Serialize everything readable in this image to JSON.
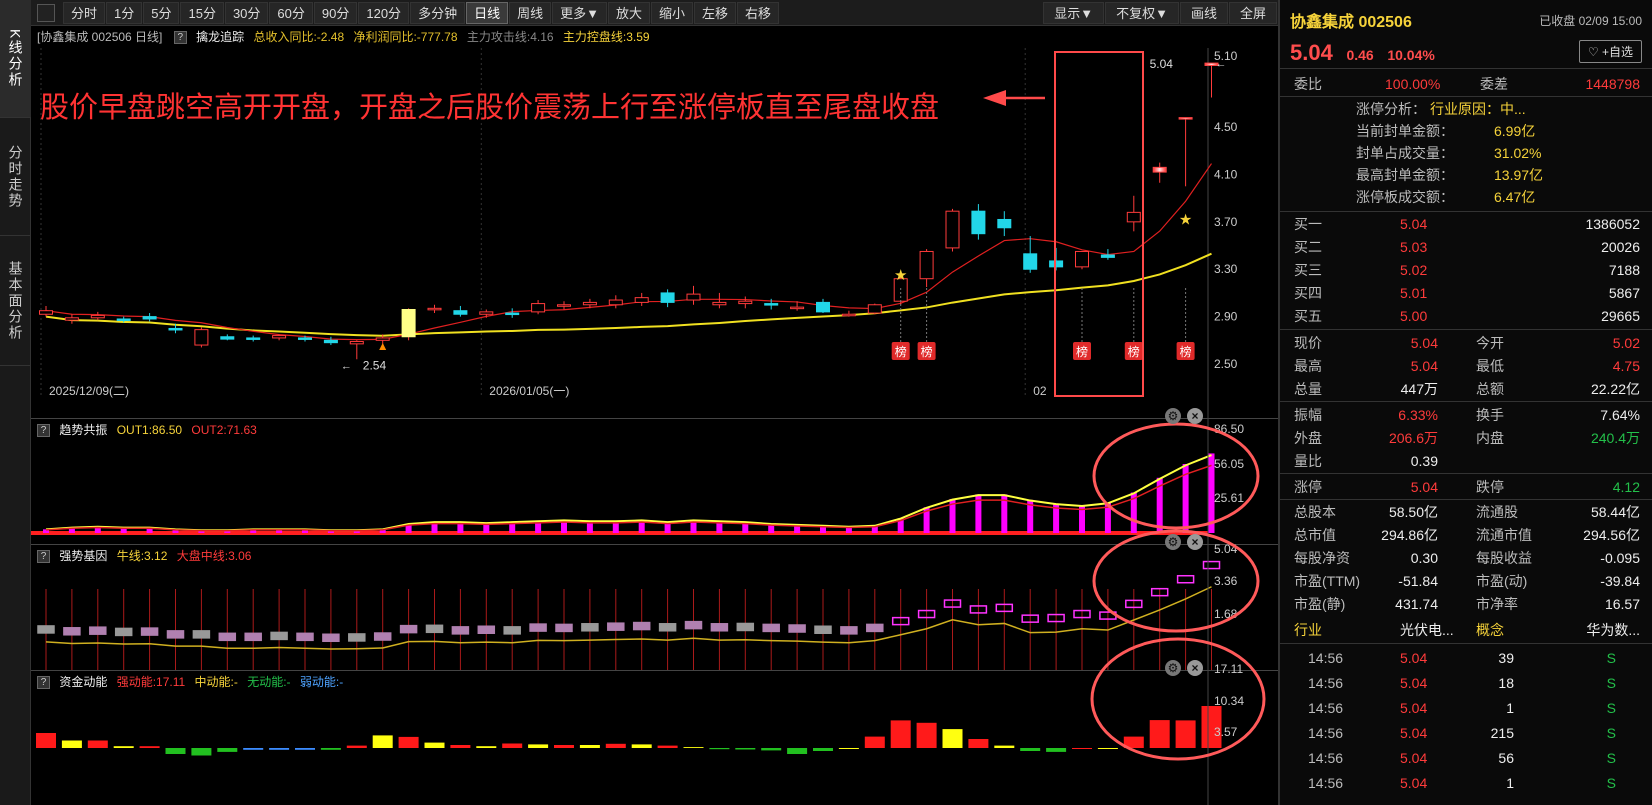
{
  "nav": {
    "tabs": [
      {
        "label": "K线分析"
      },
      {
        "label": "分时走势"
      },
      {
        "label": "基本面分析"
      }
    ]
  },
  "toolbar": {
    "buttons": [
      "分时",
      "1分",
      "5分",
      "15分",
      "30分",
      "60分",
      "90分",
      "120分",
      "多分钟",
      "日线",
      "周线",
      "更多▼",
      "放大",
      "缩小",
      "左移",
      "右移"
    ],
    "active": "日线",
    "right": [
      "显示▼",
      "不复权▼",
      "画线",
      "全屏"
    ]
  },
  "kline": {
    "info_title": "[协鑫集成 002506 日线]",
    "indicator": "擒龙追踪",
    "income": "总收入同比:-2.48",
    "profit": "净利润同比:-777.78",
    "attack": "主力攻击线:4.16",
    "control": "主力控盘线:3.59",
    "yticks": [
      "5.10",
      "4.50",
      "4.10",
      "3.70",
      "3.30",
      "2.90",
      "2.50"
    ],
    "dates": [
      "2025/12/09(二)",
      "2026/01/05(一)",
      "02"
    ],
    "low_label": "2.54",
    "high_label": "5.04",
    "bang": "榜",
    "annotation": "股价早盘跳空高开开盘，开盘之后股价震荡上行至涨停板直至尾盘收盘"
  },
  "trend": {
    "name": "趋势共振",
    "out1": "OUT1:86.50",
    "out2": "OUT2:71.63",
    "yticks": [
      "86.50",
      "56.05",
      "25.61"
    ]
  },
  "gene": {
    "name": "强势基因",
    "bull": "牛线:3.12",
    "big": "大盘中线:3.06",
    "yticks": [
      "5.04",
      "3.36",
      "1.68"
    ]
  },
  "money": {
    "name": "资金动能",
    "strong": "强动能:17.11",
    "mid": "中动能:-",
    "none": "无动能:-",
    "weak": "弱动能:-",
    "yticks": [
      "17.11",
      "10.34",
      "3.57"
    ]
  },
  "chart_data": {
    "type": "candlestick",
    "ohlc": [
      [
        2.92,
        2.99,
        2.9,
        2.95
      ],
      [
        2.87,
        2.92,
        2.84,
        2.89
      ],
      [
        2.89,
        2.94,
        2.87,
        2.91
      ],
      [
        2.88,
        2.9,
        2.85,
        2.87
      ],
      [
        2.9,
        2.93,
        2.86,
        2.88
      ],
      [
        2.8,
        2.84,
        2.76,
        2.79
      ],
      [
        2.66,
        2.81,
        2.64,
        2.79
      ],
      [
        2.73,
        2.75,
        2.7,
        2.71
      ],
      [
        2.72,
        2.74,
        2.69,
        2.71
      ],
      [
        2.72,
        2.75,
        2.7,
        2.74
      ],
      [
        2.72,
        2.74,
        2.69,
        2.71
      ],
      [
        2.7,
        2.73,
        2.66,
        2.68
      ],
      [
        2.67,
        2.7,
        2.54,
        2.69
      ],
      [
        2.7,
        2.75,
        2.65,
        2.72
      ],
      [
        2.73,
        2.97,
        2.7,
        2.96
      ],
      [
        2.96,
        3.0,
        2.93,
        2.97
      ],
      [
        2.95,
        2.99,
        2.9,
        2.92
      ],
      [
        2.92,
        2.96,
        2.89,
        2.94
      ],
      [
        2.93,
        2.97,
        2.89,
        2.92
      ],
      [
        2.94,
        3.04,
        2.92,
        3.01
      ],
      [
        2.99,
        3.03,
        2.96,
        3.0
      ],
      [
        3.0,
        3.05,
        2.97,
        3.02
      ],
      [
        3.0,
        3.08,
        2.97,
        3.04
      ],
      [
        3.02,
        3.1,
        2.99,
        3.06
      ],
      [
        3.1,
        3.13,
        2.98,
        3.02
      ],
      [
        3.04,
        3.16,
        3.0,
        3.09
      ],
      [
        3.0,
        3.1,
        2.97,
        3.02
      ],
      [
        3.01,
        3.07,
        2.97,
        3.03
      ],
      [
        3.01,
        3.05,
        2.96,
        3.0
      ],
      [
        2.98,
        3.03,
        2.95,
        2.98
      ],
      [
        3.02,
        3.05,
        2.93,
        2.94
      ],
      [
        2.92,
        2.95,
        2.9,
        2.92
      ],
      [
        2.93,
        3.01,
        2.92,
        3.0
      ],
      [
        3.03,
        3.24,
        3.0,
        3.22
      ],
      [
        3.22,
        3.47,
        3.15,
        3.45
      ],
      [
        3.48,
        3.81,
        3.45,
        3.79
      ],
      [
        3.79,
        3.85,
        3.55,
        3.6
      ],
      [
        3.72,
        3.79,
        3.58,
        3.65
      ],
      [
        3.43,
        3.58,
        3.27,
        3.3
      ],
      [
        3.37,
        3.48,
        3.29,
        3.32
      ],
      [
        3.32,
        3.43,
        3.3,
        3.45
      ],
      [
        3.42,
        3.47,
        3.38,
        3.4
      ],
      [
        3.7,
        3.92,
        3.62,
        3.78
      ],
      [
        4.12,
        4.2,
        4.03,
        4.16
      ],
      [
        4.58,
        4.58,
        4.0,
        4.58
      ],
      [
        5.02,
        5.04,
        4.75,
        5.04
      ]
    ]
  },
  "right": {
    "name": "协鑫集成 002506",
    "closed": "已收盘 02/09 15:00",
    "price": "5.04",
    "chg": "0.46",
    "pct": "10.04%",
    "fav": "♡ +自选",
    "weibi": {
      "k1": "委比",
      "v1": "100.00%",
      "k2": "委差",
      "v2": "1448798"
    },
    "zt": [
      {
        "k": "涨停分析：",
        "v": "行业原因：中..."
      },
      {
        "k": "当前封单金额：",
        "v": "6.99亿"
      },
      {
        "k": "封单占成交量：",
        "v": "31.02%"
      },
      {
        "k": "最高封单金额：",
        "v": "13.97亿"
      },
      {
        "k": "涨停板成交额：",
        "v": "6.47亿"
      }
    ],
    "bids": [
      {
        "k": "买一",
        "p": "5.04",
        "v": "1386052"
      },
      {
        "k": "买二",
        "p": "5.03",
        "v": "20026"
      },
      {
        "k": "买三",
        "p": "5.02",
        "v": "7188"
      },
      {
        "k": "买四",
        "p": "5.01",
        "v": "5867"
      },
      {
        "k": "买五",
        "p": "5.00",
        "v": "29665"
      }
    ],
    "q1": [
      {
        "k1": "现价",
        "v1": "5.04",
        "k2": "今开",
        "v2": "5.02"
      },
      {
        "k1": "最高",
        "v1": "5.04",
        "k2": "最低",
        "v2": "4.75"
      },
      {
        "k1": "总量",
        "v1": "447万",
        "k2": "总额",
        "v2": "22.22亿"
      }
    ],
    "q2": [
      {
        "k1": "振幅",
        "v1": "6.33%",
        "k2": "换手",
        "v2": "7.64%"
      },
      {
        "k1": "外盘",
        "v1": "206.6万",
        "k2": "内盘",
        "v2": "240.4万"
      },
      {
        "k1": "量比",
        "v1": "0.39",
        "k2": "",
        "v2": ""
      }
    ],
    "q3": [
      {
        "k1": "涨停",
        "v1": "5.04",
        "k2": "跌停",
        "v2": "4.12"
      }
    ],
    "q4": [
      {
        "k1": "总股本",
        "v1": "58.50亿",
        "k2": "流通股",
        "v2": "58.44亿"
      },
      {
        "k1": "总市值",
        "v1": "294.86亿",
        "k2": "流通市值",
        "v2": "294.56亿"
      },
      {
        "k1": "每股净资",
        "v1": "0.30",
        "k2": "每股收益",
        "v2": "-0.095"
      },
      {
        "k1": "市盈(TTM)",
        "v1": "-51.84",
        "k2": "市盈(动)",
        "v2": "-39.84"
      },
      {
        "k1": "市盈(静)",
        "v1": "431.74",
        "k2": "市净率",
        "v2": "16.57"
      }
    ],
    "ind": {
      "k1": "行业",
      "v1": "光伏电...",
      "k2": "概念",
      "v2": "华为数..."
    },
    "ticks": [
      {
        "t": "14:56",
        "p": "5.04",
        "v": "39",
        "s": "S"
      },
      {
        "t": "14:56",
        "p": "5.04",
        "v": "18",
        "s": "S"
      },
      {
        "t": "14:56",
        "p": "5.04",
        "v": "1",
        "s": "S"
      },
      {
        "t": "14:56",
        "p": "5.04",
        "v": "215",
        "s": "S"
      },
      {
        "t": "14:56",
        "p": "5.04",
        "v": "56",
        "s": "S"
      },
      {
        "t": "14:56",
        "p": "5.04",
        "v": "1",
        "s": "S"
      }
    ]
  }
}
